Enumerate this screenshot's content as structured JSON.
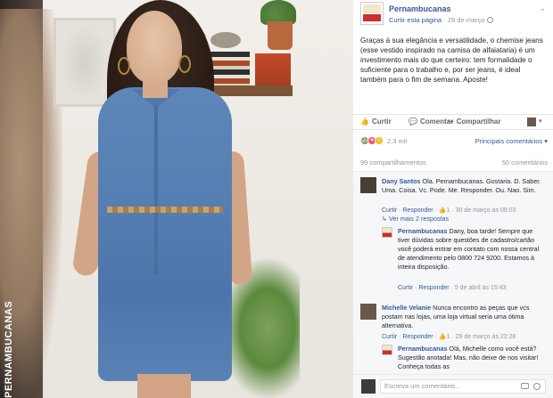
{
  "photo": {
    "brand_watermark": "PERNAMBUCANAS"
  },
  "post": {
    "page_name": "Pernambucanas",
    "like_page": "Curtir esta página",
    "separator": " · ",
    "date": "29 de março",
    "text": "Graças à sua elegância e versatilidade, o chemise jeans (esse vestido inspirado na camisa de alfaiataria) é um investimento mais do que certeiro: tem formalidade o suficiente para o trabalho e, por ser jeans, é ideal também para o fim de semana. Aposte!"
  },
  "actions": {
    "like": "Curtir",
    "comment": "Comentar",
    "share": "Compartilhar"
  },
  "reactions": {
    "count": "2,3 mil",
    "top_comments": "Principais comentários"
  },
  "stats": {
    "shares": "99 compartilhamentos",
    "comments": "50 comentários"
  },
  "comments": [
    {
      "name": "Dany Santos",
      "text": "Ola. Pernambucanas. Gostaria. D. Saber. Uma. Coisa. Vc. Pode. Me. Responder. Ou. Nao. Sim.",
      "like": "Curtir",
      "reply": "Responder",
      "likes": "1",
      "time": "30 de março às 09:03",
      "more_replies": "Ver mais 2 respostas",
      "reply_item": {
        "name": "Pernambucanas",
        "text": "Dany, boa tarde! Sempre que tiver dúvidas sobre questões de cadastro/cartão você poderá entrar em contato com nossa central de atendimento pelo 0800 724 9200. Estamos à inteira disposição.",
        "like": "Curtir",
        "reply": "Responder",
        "time": "5 de abril às 15:43"
      }
    },
    {
      "name": "Michelle Velanie",
      "text": "Nunca encontro as peças que vcs postam nas lojas, uma loja virtual seria uma ótima alternativa.",
      "like": "Curtir",
      "reply": "Responder",
      "likes": "1",
      "time": "29 de março às 22:28",
      "reply_item": {
        "name": "Pernambucanas",
        "text": "Olá, Michelle como você está? Sugestão anotada! Mas, não deixe de nos visitar! Conheça todas as"
      }
    }
  ],
  "composer": {
    "placeholder": "Escreva um comentário..."
  },
  "colors": {
    "link": "#365899",
    "muted": "#90949c",
    "like_blue": "#5890ff",
    "love_red": "#f25268",
    "wow_yellow": "#f0ba15"
  }
}
